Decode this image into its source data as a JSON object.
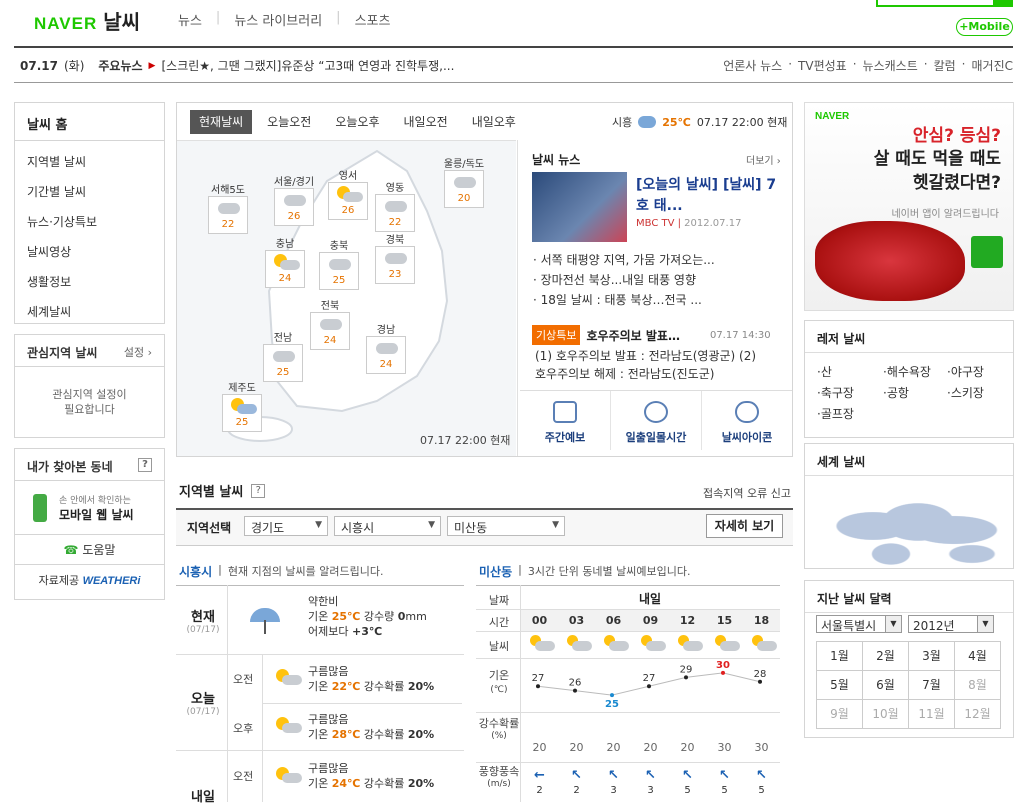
{
  "header": {
    "logo": "NAVER",
    "service": "날씨",
    "nav": [
      "뉴스",
      "뉴스 라이브러리",
      "스포츠"
    ],
    "mobile": "+Mobile"
  },
  "newsbar": {
    "date": "07.17",
    "day": "(화)",
    "label": "주요뉴스",
    "headline": "[스크린★, 그땐 그랬지]유준상 “고3때 연영과 진학투쟁,...",
    "links": [
      "언론사 뉴스",
      "TV편성표",
      "뉴스캐스트",
      "칼럼",
      "매거진C"
    ]
  },
  "sidebar": {
    "home": "날씨 홈",
    "items": [
      "지역별 날씨",
      "기간별 날씨",
      "뉴스·기상특보",
      "날씨영상",
      "생활정보",
      "세계날씨"
    ],
    "fav_title": "관심지역 날씨",
    "fav_setting": "설정",
    "fav_body1": "관심지역 설정이",
    "fav_body2": "필요합니다",
    "dong_title": "내가 찾아본 동네",
    "dong_q": "?",
    "mobile_t1": "손 안에서 확인하는",
    "mobile_t2": "모바일 웹 날씨",
    "help": "도움말",
    "source_label": "자료제공",
    "source_brand": "WEATHERi"
  },
  "tabs": [
    "현재날씨",
    "오늘오전",
    "오늘오후",
    "내일오전",
    "내일오후"
  ],
  "now": {
    "city": "시흥",
    "temp": "25℃",
    "time": "07.17 22:00 현재"
  },
  "map": {
    "regions": [
      {
        "name": "서해5도",
        "temp": "22",
        "icon": "cloud-icon"
      },
      {
        "name": "서울/경기",
        "temp": "26",
        "icon": "cloud-icon"
      },
      {
        "name": "영서",
        "temp": "26",
        "icon": "sun-cloud-icon"
      },
      {
        "name": "영동",
        "temp": "22",
        "icon": "cloud-icon"
      },
      {
        "name": "울릉/독도",
        "temp": "20",
        "icon": "cloud-icon"
      },
      {
        "name": "충남",
        "temp": "24",
        "icon": "sun-cloud-icon"
      },
      {
        "name": "충북",
        "temp": "25",
        "icon": "cloud-icon"
      },
      {
        "name": "경북",
        "temp": "23",
        "icon": "cloud-icon"
      },
      {
        "name": "전북",
        "temp": "24",
        "icon": "cloud-icon"
      },
      {
        "name": "전남",
        "temp": "25",
        "icon": "cloud-icon"
      },
      {
        "name": "경남",
        "temp": "24",
        "icon": "cloud-icon"
      },
      {
        "name": "제주도",
        "temp": "25",
        "icon": "rain-sun-icon"
      }
    ],
    "footer": "07.17 22:00 현재"
  },
  "news": {
    "title": "날씨 뉴스",
    "more": "더보기",
    "headline": "[오늘의 날씨] [날씨] 7호 태...",
    "source": "MBC TV",
    "date": "2012.07.17",
    "list": [
      "서쪽 태평양 지역, 가뭄 가져오는...",
      "장마전선 북상...내일 태풍 영향",
      "18일 날씨 : 태풍 북상…전국 ..."
    ],
    "warn_badge": "기상특보",
    "warn_title": "호우주의보 발표…",
    "warn_time": "07.17 14:30",
    "warn_text1": "(1) 호우주의보 발표 : 전라남도(영광군) (2)",
    "warn_text2": "호우주의보 해제 : 전라남도(진도군)",
    "icons": [
      "주간예보",
      "일출일몰시간",
      "날씨아이콘"
    ]
  },
  "region": {
    "title": "지역별 날씨",
    "q": "?",
    "error": "접속지역 오류 신고",
    "select_label": "지역선택",
    "sel1": "경기도",
    "sel2": "시흥시",
    "sel3": "미산동",
    "detail": "자세히 보기"
  },
  "current": {
    "city": "시흥시",
    "desc": "현재 지점의 날씨를 알려드립니다.",
    "now_label": "현재",
    "now_date": "(07/17)",
    "now_cond": "약한비",
    "now_temp_label": "기온",
    "now_temp": "25℃",
    "now_rain_label": "강수량",
    "now_rain": "0",
    "now_rain_unit": "mm",
    "now_cmp": "어제보다",
    "now_cmp_val": "+3℃",
    "today_label": "오늘",
    "today_date": "(07/17)",
    "tomorrow_label": "내일",
    "am": "오전",
    "pm": "오후",
    "rows": [
      {
        "cond": "구름많음",
        "temp": "22℃",
        "prob": "20%"
      },
      {
        "cond": "구름많음",
        "temp": "28℃",
        "prob": "20%"
      },
      {
        "cond": "구름많음",
        "temp": "24℃",
        "prob": "20%"
      }
    ],
    "temp_label": "기온",
    "prob_label": "강수확률"
  },
  "dong": {
    "name": "미산동",
    "desc": "3시간 단위 동네별 날씨예보입니다.",
    "date_label": "날짜",
    "date": "내일",
    "time_label": "시간",
    "weather_label": "날씨",
    "temp_label": "기온",
    "temp_unit": "(℃)",
    "prob_label": "강수확률",
    "prob_unit": "(%)",
    "wind_label": "풍향풍속",
    "wind_unit": "(m/s)",
    "hours": [
      "00",
      "03",
      "06",
      "09",
      "12",
      "15",
      "18"
    ],
    "temps": [
      27,
      26,
      25,
      27,
      29,
      30,
      28
    ],
    "probs": [
      "20",
      "20",
      "20",
      "20",
      "20",
      "30",
      "30"
    ],
    "winds": [
      "2",
      "2",
      "3",
      "3",
      "5",
      "5",
      "5"
    ],
    "wind_dirs": [
      "←",
      "↖",
      "↖",
      "↖",
      "↖",
      "↖",
      "↖"
    ]
  },
  "right": {
    "ad_brand": "NAVER",
    "ad_l1": "안심? 등심?",
    "ad_l2a": "살 때도 먹을 때도",
    "ad_l2b": "헷갈렸다면?",
    "ad_l3": "네이버 앱이 알려드립니다",
    "leisure_title": "레저 날씨",
    "leisure": [
      "·산",
      "·해수욕장",
      "·야구장",
      "·축구장",
      "·공항",
      "·스키장",
      "·골프장"
    ],
    "world_title": "세계 날씨",
    "cal_title": "지난 날씨 달력",
    "cal_city": "서울특별시",
    "cal_year": "2012년",
    "months": [
      "1월",
      "2월",
      "3월",
      "4월",
      "5월",
      "6월",
      "7월",
      "8월",
      "9월",
      "10월",
      "11월",
      "12월"
    ]
  }
}
